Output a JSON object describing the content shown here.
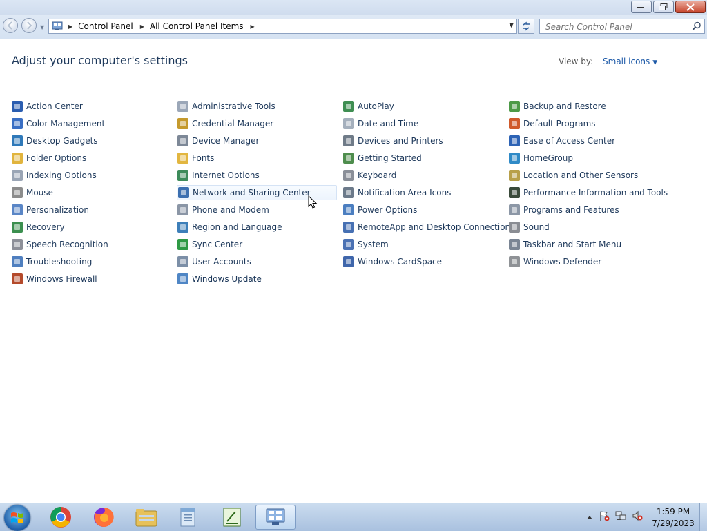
{
  "address": {
    "crumbs": [
      "Control Panel",
      "All Control Panel Items"
    ]
  },
  "search": {
    "placeholder": "Search Control Panel"
  },
  "content": {
    "heading": "Adjust your computer's settings",
    "view_by_label": "View by:",
    "view_by_value": "Small icons"
  },
  "columns": [
    [
      {
        "label": "Action Center",
        "icon": "flag-icon",
        "color": "#2a5db0"
      },
      {
        "label": "Color Management",
        "icon": "monitor-color-icon",
        "color": "#3a6fc4"
      },
      {
        "label": "Desktop Gadgets",
        "icon": "gadgets-icon",
        "color": "#2f79b9"
      },
      {
        "label": "Folder Options",
        "icon": "folder-icon",
        "color": "#e1b43d"
      },
      {
        "label": "Indexing Options",
        "icon": "indexing-icon",
        "color": "#9aa5b5"
      },
      {
        "label": "Mouse",
        "icon": "mouse-icon",
        "color": "#8c8c8c"
      },
      {
        "label": "Personalization",
        "icon": "personalization-icon",
        "color": "#5a86c6"
      },
      {
        "label": "Recovery",
        "icon": "recovery-icon",
        "color": "#3b8f4f"
      },
      {
        "label": "Speech Recognition",
        "icon": "microphone-icon",
        "color": "#8d9099"
      },
      {
        "label": "Troubleshooting",
        "icon": "troubleshooting-icon",
        "color": "#4f7fbf"
      },
      {
        "label": "Windows Firewall",
        "icon": "firewall-icon",
        "color": "#b44a2b"
      }
    ],
    [
      {
        "label": "Administrative Tools",
        "icon": "admin-tools-icon",
        "color": "#9ba7b8"
      },
      {
        "label": "Credential Manager",
        "icon": "credential-icon",
        "color": "#c59a2d"
      },
      {
        "label": "Device Manager",
        "icon": "device-manager-icon",
        "color": "#7d8897"
      },
      {
        "label": "Fonts",
        "icon": "fonts-icon",
        "color": "#e2b640"
      },
      {
        "label": "Internet Options",
        "icon": "globe-icon",
        "color": "#3d8b5a"
      },
      {
        "label": "Network and Sharing Center",
        "icon": "network-icon",
        "color": "#3c6fb0"
      },
      {
        "label": "Phone and Modem",
        "icon": "phone-icon",
        "color": "#8b96a6"
      },
      {
        "label": "Region and Language",
        "icon": "region-icon",
        "color": "#3d7fb9"
      },
      {
        "label": "Sync Center",
        "icon": "sync-icon",
        "color": "#2f9a45"
      },
      {
        "label": "User Accounts",
        "icon": "users-icon",
        "color": "#7c8fa7"
      },
      {
        "label": "Windows Update",
        "icon": "update-icon",
        "color": "#4f86c5"
      }
    ],
    [
      {
        "label": "AutoPlay",
        "icon": "autoplay-icon",
        "color": "#3f8e52"
      },
      {
        "label": "Date and Time",
        "icon": "clock-icon",
        "color": "#a5b0bd"
      },
      {
        "label": "Devices and Printers",
        "icon": "printer-icon",
        "color": "#6f7b88"
      },
      {
        "label": "Getting Started",
        "icon": "getting-started-icon",
        "color": "#4e8d4d"
      },
      {
        "label": "Keyboard",
        "icon": "keyboard-icon",
        "color": "#8a8f98"
      },
      {
        "label": "Notification Area Icons",
        "icon": "notification-icon",
        "color": "#6c7a8a"
      },
      {
        "label": "Power Options",
        "icon": "power-icon",
        "color": "#4b7ec0"
      },
      {
        "label": "RemoteApp and Desktop Connections",
        "icon": "remoteapp-icon",
        "color": "#4670b3"
      },
      {
        "label": "System",
        "icon": "system-icon",
        "color": "#4b72b4"
      },
      {
        "label": "Windows CardSpace",
        "icon": "cardspace-icon",
        "color": "#3f66ab"
      }
    ],
    [
      {
        "label": "Backup and Restore",
        "icon": "backup-icon",
        "color": "#4d9a47"
      },
      {
        "label": "Default Programs",
        "icon": "default-programs-icon",
        "color": "#d05a2b"
      },
      {
        "label": "Ease of Access Center",
        "icon": "ease-of-access-icon",
        "color": "#2d63b5"
      },
      {
        "label": "HomeGroup",
        "icon": "homegroup-icon",
        "color": "#2f8ac7"
      },
      {
        "label": "Location and Other Sensors",
        "icon": "sensors-icon",
        "color": "#b8a04a"
      },
      {
        "label": "Performance Information and Tools",
        "icon": "performance-icon",
        "color": "#3a4a3a"
      },
      {
        "label": "Programs and Features",
        "icon": "programs-icon",
        "color": "#8c97a6"
      },
      {
        "label": "Sound",
        "icon": "speaker-icon",
        "color": "#8a8d93"
      },
      {
        "label": "Taskbar and Start Menu",
        "icon": "taskbar-icon",
        "color": "#7a8594"
      },
      {
        "label": "Windows Defender",
        "icon": "defender-icon",
        "color": "#8f9296"
      }
    ]
  ],
  "hovered_item": "Network and Sharing Center",
  "taskbar": {
    "apps": [
      "chrome-icon",
      "firefox-icon",
      "file-explorer-icon",
      "notepad-icon",
      "text-editor-icon",
      "control-panel-icon"
    ],
    "time": "1:59 PM",
    "date": "7/29/2023"
  }
}
